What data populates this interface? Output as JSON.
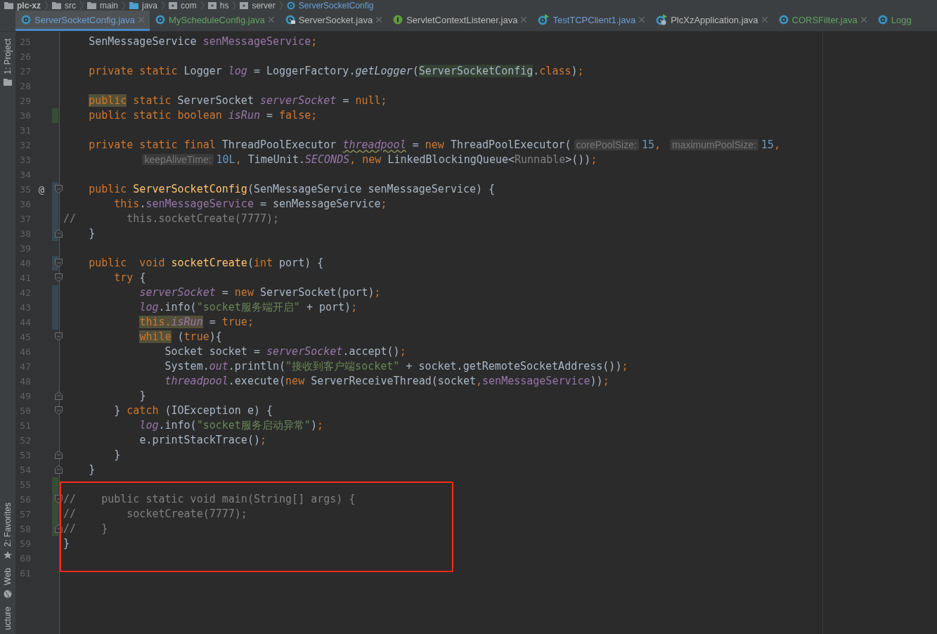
{
  "breadcrumbs": [
    {
      "label": "plc-xz",
      "kind": "project"
    },
    {
      "label": "src",
      "kind": "folder"
    },
    {
      "label": "main",
      "kind": "folder"
    },
    {
      "label": "java",
      "kind": "source-folder"
    },
    {
      "label": "com",
      "kind": "package"
    },
    {
      "label": "hs",
      "kind": "package"
    },
    {
      "label": "server",
      "kind": "package"
    },
    {
      "label": "ServerSocketConfig",
      "kind": "class"
    }
  ],
  "tabs": [
    {
      "label": "ServerSocketConfig.java",
      "kind": "class",
      "color": "#6a9fd8",
      "selected": true
    },
    {
      "label": "MyScheduleConfig.java",
      "kind": "class",
      "color": "#62a362",
      "selected": false
    },
    {
      "label": "ServerSocket.java",
      "kind": "class-lock",
      "color": "#bbbbbb",
      "selected": false
    },
    {
      "label": "ServletContextListener.java",
      "kind": "interface",
      "color": "#bbbbbb",
      "selected": false
    },
    {
      "label": "TestTCPClient1.java",
      "kind": "run",
      "color": "#6a9fd8",
      "selected": false
    },
    {
      "label": "PlcXzApplication.java",
      "kind": "spring-run",
      "color": "#bbbbbb",
      "selected": false
    },
    {
      "label": "CORSFilter.java",
      "kind": "class",
      "color": "#62a362",
      "selected": false
    },
    {
      "label": "Logg",
      "kind": "class",
      "color": "#62a362",
      "selected": false
    }
  ],
  "tool_strip_top": [
    {
      "label": "1: Project",
      "kind": "folder"
    }
  ],
  "tool_strip_bottom": [
    {
      "label": "2: Favorites",
      "kind": "star"
    },
    {
      "label": "Web",
      "kind": "globe"
    },
    {
      "label": "ucture",
      "kind": "plain"
    }
  ],
  "lines": [
    {
      "number": "25",
      "tokens": [
        {
          "text": "    SenMessageService ",
          "kind": "plain"
        },
        {
          "text": "senMessageService",
          "kind": "field"
        },
        {
          "text": ";",
          "kind": "punct"
        }
      ]
    },
    {
      "number": "26"
    },
    {
      "number": "27",
      "tokens": [
        {
          "text": "    private static ",
          "kind": "keyword"
        },
        {
          "text": "Logger ",
          "kind": "plain"
        },
        {
          "text": "log",
          "kind": "static-field"
        },
        {
          "text": " = LoggerFactory.",
          "kind": "plain"
        },
        {
          "text": "getLogger",
          "kind": "static-call"
        },
        {
          "text": "(",
          "kind": "plain"
        },
        {
          "text": "ServerSocketConfig",
          "kind": "ref-match"
        },
        {
          "text": ".",
          "kind": "plain"
        },
        {
          "text": "class",
          "kind": "keyword"
        },
        {
          "text": ")",
          "kind": "plain"
        },
        {
          "text": ";",
          "kind": "punct"
        }
      ]
    },
    {
      "number": "28"
    },
    {
      "number": "29",
      "tokens": [
        {
          "text": "    public",
          "kind": "keyword-match"
        },
        {
          "text": " static ",
          "kind": "keyword"
        },
        {
          "text": "ServerSocket ",
          "kind": "plain"
        },
        {
          "text": "serverSocket",
          "kind": "static-field"
        },
        {
          "text": " = ",
          "kind": "plain"
        },
        {
          "text": "null",
          "kind": "keyword"
        },
        {
          "text": ";",
          "kind": "punct"
        }
      ]
    },
    {
      "number": "30",
      "change_marker": {
        "kind": "added"
      },
      "tokens": [
        {
          "text": "    public static boolean ",
          "kind": "keyword"
        },
        {
          "text": "isRun",
          "kind": "static-field"
        },
        {
          "text": " = ",
          "kind": "plain"
        },
        {
          "text": "false",
          "kind": "keyword"
        },
        {
          "text": ";",
          "kind": "punct"
        }
      ]
    },
    {
      "number": "31"
    },
    {
      "number": "32",
      "tokens": [
        {
          "text": "    private static final ",
          "kind": "keyword"
        },
        {
          "text": "ThreadPoolExecutor ",
          "kind": "plain"
        },
        {
          "text": "threadpool",
          "kind": "static-field-warn"
        },
        {
          "text": " = ",
          "kind": "plain"
        },
        {
          "text": "new ",
          "kind": "keyword"
        },
        {
          "text": "ThreadPoolExecutor(",
          "kind": "plain"
        },
        {
          "text": "corePoolSize:",
          "kind": "hint"
        },
        {
          "text": "15",
          "kind": "number"
        },
        {
          "text": ", ",
          "kind": "punct"
        },
        {
          "text": "maximumPoolSize:",
          "kind": "hint"
        },
        {
          "text": "15",
          "kind": "number"
        },
        {
          "text": ",",
          "kind": "punct"
        }
      ]
    },
    {
      "number": "33",
      "tokens": [
        {
          "text": "            keepAliveTime:",
          "kind": "hint"
        },
        {
          "text": "10L",
          "kind": "number"
        },
        {
          "text": ", ",
          "kind": "punct"
        },
        {
          "text": "TimeUnit.",
          "kind": "plain"
        },
        {
          "text": "SECONDS",
          "kind": "static-field"
        },
        {
          "text": ", ",
          "kind": "punct"
        },
        {
          "text": "new ",
          "kind": "keyword"
        },
        {
          "text": "LinkedBlockingQueue<",
          "kind": "plain"
        },
        {
          "text": "Runnable",
          "kind": "redundant"
        },
        {
          "text": ">())",
          "kind": "plain"
        },
        {
          "text": ";",
          "kind": "punct"
        }
      ]
    },
    {
      "number": "34"
    },
    {
      "number": "35",
      "marker": "@",
      "fold_marker": {
        "kind": "start"
      },
      "change_marker": {
        "kind": "modified"
      },
      "tokens": [
        {
          "text": "    public ",
          "kind": "keyword"
        },
        {
          "text": "ServerSocketConfig",
          "kind": "method-decl"
        },
        {
          "text": "(SenMessageService senMessageService) {",
          "kind": "plain"
        }
      ]
    },
    {
      "number": "36",
      "change_marker": {
        "kind": "modified"
      },
      "tokens": [
        {
          "text": "        this",
          "kind": "keyword"
        },
        {
          "text": ".",
          "kind": "plain"
        },
        {
          "text": "senMessageService",
          "kind": "field"
        },
        {
          "text": " = senMessageService",
          "kind": "plain"
        },
        {
          "text": ";",
          "kind": "punct"
        }
      ]
    },
    {
      "number": "37",
      "change_marker": {
        "kind": "modified"
      },
      "tokens": [
        {
          "text": "//        this.socketCreate(7777);",
          "kind": "comment"
        }
      ]
    },
    {
      "number": "38",
      "fold_marker": {
        "kind": "end"
      },
      "change_marker": {
        "kind": "modified"
      },
      "tokens": [
        {
          "text": "    }",
          "kind": "plain"
        }
      ]
    },
    {
      "number": "39"
    },
    {
      "number": "40",
      "fold_marker": {
        "kind": "start"
      },
      "change_marker": {
        "kind": "modified"
      },
      "tokens": [
        {
          "text": "    public  void ",
          "kind": "keyword"
        },
        {
          "text": "socketCreate",
          "kind": "method-decl"
        },
        {
          "text": "(",
          "kind": "plain"
        },
        {
          "text": "int ",
          "kind": "keyword"
        },
        {
          "text": "port) {",
          "kind": "plain"
        }
      ]
    },
    {
      "number": "41",
      "fold_marker": {
        "kind": "start"
      },
      "tokens": [
        {
          "text": "        try ",
          "kind": "keyword"
        },
        {
          "text": "{",
          "kind": "plain"
        }
      ]
    },
    {
      "number": "42",
      "change_marker": {
        "kind": "modified"
      },
      "tokens": [
        {
          "text": "            serverSocket",
          "kind": "static-field"
        },
        {
          "text": " = ",
          "kind": "plain"
        },
        {
          "text": "new ",
          "kind": "keyword"
        },
        {
          "text": "ServerSocket(port)",
          "kind": "plain"
        },
        {
          "text": ";",
          "kind": "punct"
        }
      ]
    },
    {
      "number": "43",
      "change_marker": {
        "kind": "modified"
      },
      "tokens": [
        {
          "text": "            log",
          "kind": "static-field"
        },
        {
          "text": ".info(",
          "kind": "plain"
        },
        {
          "text": "\"socket服务端开启\"",
          "kind": "string"
        },
        {
          "text": " + port)",
          "kind": "plain"
        },
        {
          "text": ";",
          "kind": "punct"
        }
      ]
    },
    {
      "number": "44",
      "change_marker": {
        "kind": "modified"
      },
      "tokens": [
        {
          "text": "            this.",
          "kind": "keyword-match"
        },
        {
          "text": "isRun",
          "kind": "field-match"
        },
        {
          "text": " = ",
          "kind": "plain"
        },
        {
          "text": "true",
          "kind": "keyword"
        },
        {
          "text": ";",
          "kind": "punct"
        }
      ]
    },
    {
      "number": "45",
      "fold_marker": {
        "kind": "start"
      },
      "tokens": [
        {
          "text": "            while",
          "kind": "keyword-match"
        },
        {
          "text": " (",
          "kind": "plain"
        },
        {
          "text": "true",
          "kind": "keyword"
        },
        {
          "text": "){",
          "kind": "plain"
        }
      ]
    },
    {
      "number": "46",
      "tokens": [
        {
          "text": "                Socket socket = ",
          "kind": "plain"
        },
        {
          "text": "serverSocket",
          "kind": "static-field"
        },
        {
          "text": ".accept()",
          "kind": "plain"
        },
        {
          "text": ";",
          "kind": "punct"
        }
      ]
    },
    {
      "number": "47",
      "tokens": [
        {
          "text": "                System.",
          "kind": "plain"
        },
        {
          "text": "out",
          "kind": "static-field"
        },
        {
          "text": ".println(",
          "kind": "plain"
        },
        {
          "text": "\"接收到客户端socket\"",
          "kind": "string"
        },
        {
          "text": " + socket.getRemoteSocketAddress())",
          "kind": "plain"
        },
        {
          "text": ";",
          "kind": "punct"
        }
      ]
    },
    {
      "number": "48",
      "tokens": [
        {
          "text": "                threadpool",
          "kind": "static-field"
        },
        {
          "text": ".execute(",
          "kind": "plain"
        },
        {
          "text": "new ",
          "kind": "keyword"
        },
        {
          "text": "ServerReceiveThread(socket",
          "kind": "plain"
        },
        {
          "text": ",",
          "kind": "punct"
        },
        {
          "text": "senMessageService",
          "kind": "field"
        },
        {
          "text": "))",
          "kind": "plain"
        },
        {
          "text": ";",
          "kind": "punct"
        }
      ]
    },
    {
      "number": "49",
      "fold_marker": {
        "kind": "end"
      },
      "tokens": [
        {
          "text": "            }",
          "kind": "plain"
        }
      ]
    },
    {
      "number": "50",
      "fold_marker": {
        "kind": "start"
      },
      "tokens": [
        {
          "text": "        } ",
          "kind": "plain"
        },
        {
          "text": "catch ",
          "kind": "keyword"
        },
        {
          "text": "(IOException e) {",
          "kind": "plain"
        }
      ]
    },
    {
      "number": "51",
      "tokens": [
        {
          "text": "            log",
          "kind": "static-field"
        },
        {
          "text": ".info(",
          "kind": "plain"
        },
        {
          "text": "\"socket服务启动异常\"",
          "kind": "string"
        },
        {
          "text": ")",
          "kind": "plain"
        },
        {
          "text": ";",
          "kind": "punct"
        }
      ]
    },
    {
      "number": "52",
      "tokens": [
        {
          "text": "            e.printStackTrace()",
          "kind": "plain"
        },
        {
          "text": ";",
          "kind": "punct"
        }
      ]
    },
    {
      "number": "53",
      "fold_marker": {
        "kind": "end"
      },
      "tokens": [
        {
          "text": "        }",
          "kind": "plain"
        }
      ]
    },
    {
      "number": "54",
      "fold_marker": {
        "kind": "end"
      },
      "tokens": [
        {
          "text": "    }",
          "kind": "plain"
        }
      ]
    },
    {
      "number": "55",
      "change_marker": {
        "kind": "added"
      }
    },
    {
      "number": "56",
      "fold_marker": {
        "kind": "start"
      },
      "change_marker": {
        "kind": "added"
      },
      "tokens": [
        {
          "text": "//    public static void main(String[] args) {",
          "kind": "comment"
        }
      ]
    },
    {
      "number": "57",
      "change_marker": {
        "kind": "added"
      },
      "tokens": [
        {
          "text": "//        socketCreate(7777);",
          "kind": "comment"
        }
      ]
    },
    {
      "number": "58",
      "fold_marker": {
        "kind": "end"
      },
      "change_marker": {
        "kind": "added"
      },
      "tokens": [
        {
          "text": "//    }",
          "kind": "comment"
        }
      ]
    },
    {
      "number": "59",
      "tokens": [
        {
          "text": "}",
          "kind": "plain"
        }
      ]
    },
    {
      "number": "60"
    },
    {
      "number": "61"
    }
  ],
  "annotation": {
    "kind": "highlight-box",
    "color": "#ff2a1a"
  }
}
